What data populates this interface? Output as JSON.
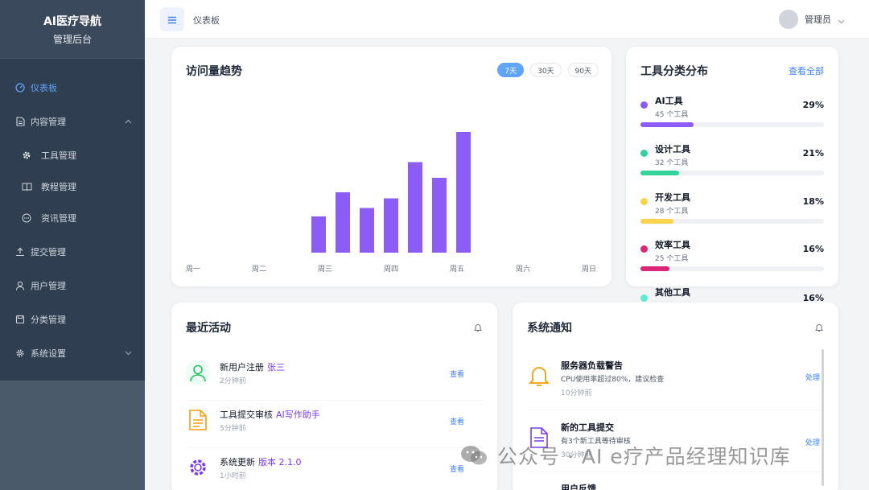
{
  "sidebar": {
    "title": "AI医疗导航",
    "subtitle": "管理后台",
    "items": [
      {
        "label": "仪表板",
        "icon": "dashboard-icon"
      },
      {
        "label": "内容管理",
        "icon": "document-icon"
      },
      {
        "label": "工具管理",
        "icon": "gear-icon"
      },
      {
        "label": "教程管理",
        "icon": "book-icon"
      },
      {
        "label": "资讯管理",
        "icon": "chat-icon"
      },
      {
        "label": "提交管理",
        "icon": "upload-icon"
      },
      {
        "label": "用户管理",
        "icon": "user-icon"
      },
      {
        "label": "分类管理",
        "icon": "save-icon"
      },
      {
        "label": "系统设置",
        "icon": "settings-icon"
      }
    ]
  },
  "topbar": {
    "breadcrumb": "仪表板",
    "user_name": "管理员"
  },
  "visits_card": {
    "title": "访问量趋势",
    "ranges": [
      "7天",
      "30天",
      "90天"
    ],
    "active_range": "7天"
  },
  "chart_data": {
    "type": "bar",
    "categories": [
      "周一",
      "周二",
      "周三",
      "周四",
      "周五",
      "周六",
      "周日"
    ],
    "bar_color": "#8b5cf6",
    "ylim": [
      0,
      10
    ],
    "bars": [
      {
        "label": "周三",
        "value": 3.0
      },
      {
        "label": "周三",
        "value": 5.0
      },
      {
        "label": "周四",
        "value": 3.7
      },
      {
        "label": "周四",
        "value": 4.5
      },
      {
        "label": "周四",
        "value": 7.5
      },
      {
        "label": "周五",
        "value": 6.2
      },
      {
        "label": "周五",
        "value": 10.0
      }
    ],
    "grid": false
  },
  "category_card": {
    "title": "工具分类分布",
    "view_all": "查看全部",
    "items": [
      {
        "name": "AI工具",
        "count": "45 个工具",
        "percent": "29%",
        "value": 0.29,
        "color": "#8b5cf6"
      },
      {
        "name": "设计工具",
        "count": "32 个工具",
        "percent": "21%",
        "value": 0.21,
        "color": "#34d399"
      },
      {
        "name": "开发工具",
        "count": "28 个工具",
        "percent": "18%",
        "value": 0.18,
        "color": "#fcd34d"
      },
      {
        "name": "效率工具",
        "count": "25 个工具",
        "percent": "16%",
        "value": 0.16,
        "color": "#db2777"
      },
      {
        "name": "其他工具",
        "count": "",
        "percent": "16%",
        "value": 0.16,
        "color": "#5eead4"
      }
    ]
  },
  "activity_card": {
    "title": "最近活动",
    "items": [
      {
        "text": "新用户注册",
        "highlight": "张三",
        "time": "2分钟前",
        "action": "查看",
        "icon": "user-icon",
        "color": "#22c55e"
      },
      {
        "text": "工具提交审核",
        "highlight": "AI写作助手",
        "time": "5分钟前",
        "action": "查看",
        "icon": "document-icon",
        "color": "#f59e0b"
      },
      {
        "text": "系统更新",
        "highlight": "版本 2.1.0",
        "time": "1小时前",
        "action": "查看",
        "icon": "gear-icon",
        "color": "#7c3aed"
      }
    ]
  },
  "notice_card": {
    "title": "系统通知",
    "items": [
      {
        "title": "服务器负载警告",
        "desc": "CPU使用率超过80%，建议检查",
        "time": "10分钟前",
        "action": "处理",
        "icon": "bell-icon",
        "color": "#f59e0b"
      },
      {
        "title": "新的工具提交",
        "desc": "有3个新工具等待审核",
        "time": "30分钟前",
        "action": "处理",
        "icon": "document-icon",
        "color": "#7c3aed"
      },
      {
        "title": "用户反馈",
        "desc": "",
        "time": "",
        "action": "",
        "icon": "chat-icon",
        "color": "#3b82f6"
      }
    ]
  },
  "watermark": {
    "text": "公众号 · AI e疗产品经理知识库"
  }
}
